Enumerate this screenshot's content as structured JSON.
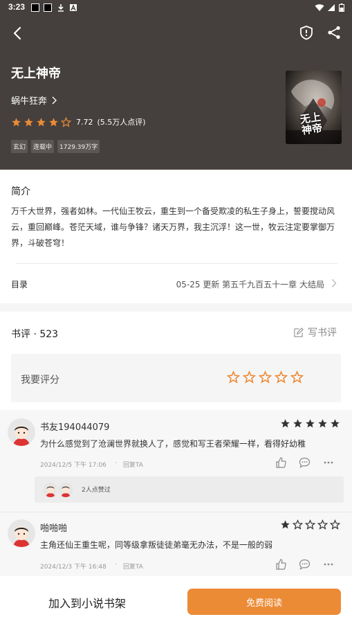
{
  "status_bar": {
    "time": "3:23"
  },
  "colors": {
    "header_bg": "#45403d",
    "accent": "#ec8b36",
    "star_dark": "#333333"
  },
  "book": {
    "title": "无上神帝",
    "author": "蜗牛狂奔",
    "rating_value": "7.72",
    "rating_count": "(5.5万人点评)",
    "rating_stars": 4,
    "tags": [
      "玄幻",
      "连载中",
      "1729.39万字"
    ],
    "cover_text": "无上神帝"
  },
  "intro": {
    "title": "简介",
    "text": "万千大世界，强者如林。一代仙王牧云，重生到一个备受欺凌的私生子身上，誓要搅动风云，重回巅峰。苍茫天域，谁与争锋？诸天万界，我主沉浮！这一世，牧云注定要掌御万界，斗破苍穹！"
  },
  "toc": {
    "label": "目录",
    "info": "05-25  更新  第五千九百五十一章 大结局"
  },
  "reviews": {
    "header": "书评 · 523",
    "write_label": "写书评",
    "my_rating_label": "我要评分",
    "comments": [
      {
        "user": "书友194044079",
        "stars": 5,
        "text": "为什么感觉到了沧澜世界就换人了，感觉和写王者荣耀一样，看得好幼稚",
        "time": "2024/12/5 下午 17:06",
        "reply": "回复TA",
        "likes_text": "2人点赞过"
      },
      {
        "user": "啪啪啪",
        "stars": 1,
        "text": "主角还仙王重生呢，同等级拿叛徒徒弟毫无办法，不是一般的弱",
        "time": "2024/12/3 下午 16:48",
        "reply": "回复TA"
      }
    ]
  },
  "bottom": {
    "shelf_label": "加入到小说书架",
    "read_label": "免费阅读"
  }
}
